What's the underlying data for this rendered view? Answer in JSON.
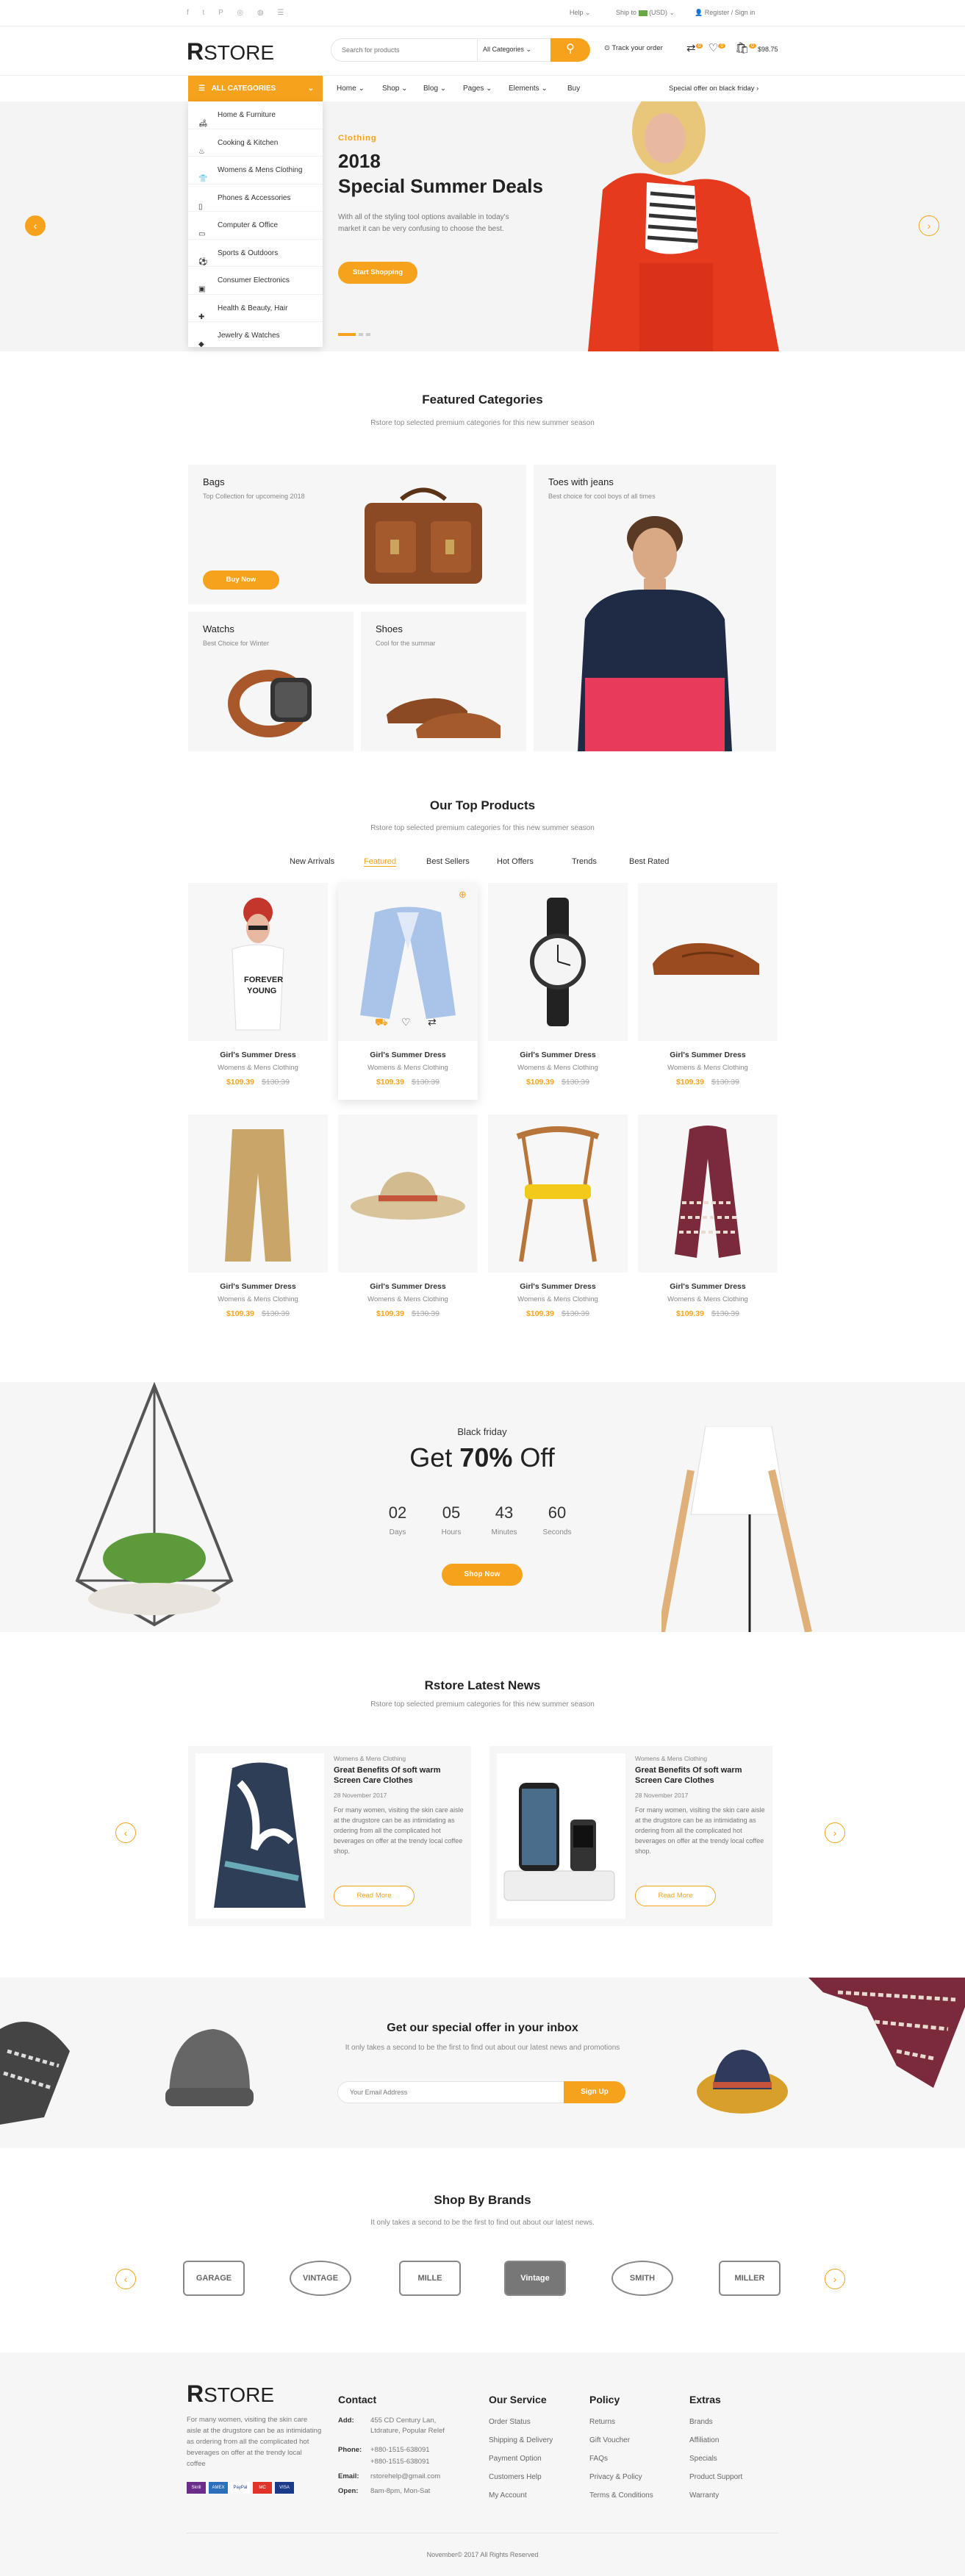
{
  "topbar": {
    "help": "Help",
    "ship_to": "Ship to",
    "currency": "(USD)",
    "register": "Register / Sign in"
  },
  "header": {
    "logo_r": "R",
    "logo_store": "STORE",
    "search_placeholder": "Search for products",
    "category_select": "All Categories",
    "track": "Track your order",
    "compare_count": "0",
    "wish_count": "0",
    "cart_count": "0",
    "cart_total": "$98.75"
  },
  "nav": {
    "all_categories": "ALL CATEGORIES",
    "items": [
      "Home",
      "Shop",
      "Blog",
      "Pages",
      "Elements",
      "Buy"
    ],
    "offer": "Special offer on black friday"
  },
  "sidebar": [
    "Home & Furniture",
    "Cooking & Kitchen",
    "Womens & Mens Clothing",
    "Phones & Accessories",
    "Computer & Office",
    "Sports & Outdoors",
    "Consumer Electronics",
    "Health & Beauty, Hair",
    "Jewelry & Watches"
  ],
  "hero": {
    "tag": "Clothing",
    "year": "2018",
    "title": "Special Summer Deals",
    "desc": "With all of the styling tool options available in today's market it can be very confusing to choose the best.",
    "button": "Start Shopping"
  },
  "featured": {
    "title": "Featured Categories",
    "subtitle": "Rstore top selected premium categories for this new summer season",
    "bags_title": "Bags",
    "bags_sub": "Top Collection for upcomeing 2018",
    "bags_btn": "Buy Now",
    "toes_title": "Toes with jeans",
    "toes_sub": "Best choice for cool boys of all times",
    "watches_title": "Watchs",
    "watches_sub": "Best Choice for Winter",
    "shoes_title": "Shoes",
    "shoes_sub": "Cool for the summar"
  },
  "top_products": {
    "title": "Our Top Products",
    "subtitle": "Rstore top selected premium categories for this new summer season",
    "tabs": [
      "New Arrivals",
      "Featured",
      "Best Sellers",
      "Hot Offers",
      "Trends",
      "Best Rated"
    ],
    "products": [
      {
        "name": "Girl's Summer Dress",
        "cat": "Womens & Mens Clothing",
        "price": "$109.39",
        "old": "$130.39"
      },
      {
        "name": "Girl's Summer Dress",
        "cat": "Womens & Mens Clothing",
        "price": "$109.39",
        "old": "$130.39"
      },
      {
        "name": "Girl's Summer Dress",
        "cat": "Womens & Mens Clothing",
        "price": "$109.39",
        "old": "$130.39"
      },
      {
        "name": "Girl's Summer Dress",
        "cat": "Womens & Mens Clothing",
        "price": "$109.39",
        "old": "$130.39"
      },
      {
        "name": "Girl's Summer Dress",
        "cat": "Womens & Mens Clothing",
        "price": "$109.39",
        "old": "$130.39"
      },
      {
        "name": "Girl's Summer Dress",
        "cat": "Womens & Mens Clothing",
        "price": "$109.39",
        "old": "$130.39"
      },
      {
        "name": "Girl's Summer Dress",
        "cat": "Womens & Mens Clothing",
        "price": "$109.39",
        "old": "$130.39"
      },
      {
        "name": "Girl's Summer Dress",
        "cat": "Womens & Mens Clothing",
        "price": "$109.39",
        "old": "$130.39"
      }
    ]
  },
  "black_friday": {
    "label": "Black friday",
    "get": "Get",
    "pct": "70%",
    "off": "Off",
    "days": "02",
    "days_l": "Days",
    "hours": "05",
    "hours_l": "Hours",
    "minutes": "43",
    "minutes_l": "Minutes",
    "seconds": "60",
    "seconds_l": "Seconds",
    "button": "Shop Now"
  },
  "news": {
    "title": "Rstore Latest News",
    "subtitle": "Rstore top selected premium categories for this new summer season",
    "items": [
      {
        "cat": "Womens & Mens Clothing",
        "title": "Great Benefits Of soft warm Screen Care Clothes",
        "date": "28 November 2017",
        "body": "For many women, visiting the skin care aisle at the drugstore can be as intimidating as ordering from all the complicated hot beverages on offer at the trendy local coffee shop.",
        "btn": "Read More"
      },
      {
        "cat": "Womens & Mens Clothing",
        "title": "Great Benefits Of soft warm Screen Care Clothes",
        "date": "28 November 2017",
        "body": "For many women, visiting the skin care aisle at the drugstore can be as intimidating as ordering from all the complicated hot beverages on offer at the trendy local coffee shop.",
        "btn": "Read More"
      }
    ]
  },
  "newsletter": {
    "title": "Get our special offer in your inbox",
    "subtitle": "It only takes a second to be the first to find out about our latest news and promotions",
    "placeholder": "Your Email Address",
    "button": "Sign Up"
  },
  "brands": {
    "title": "Shop By Brands",
    "subtitle": "It only takes a second to be the first to find out about our latest news.",
    "names": [
      "GARAGE",
      "VINTAGE",
      "MILLE",
      "Vintage",
      "SMITH",
      "MILLER"
    ]
  },
  "footer": {
    "logo_r": "R",
    "logo_store": "STORE",
    "about": "For many women, visiting the skin care aisle at the drugstore can be as intimidating as ordering from all the complicated hot beverages on offer at the trendy local coffee",
    "contact_title": "Contact",
    "add_l": "Add:",
    "add_v": "455 CD Century Lan, Ltdrature, Popular Relef",
    "phone_l": "Phone:",
    "phone1": "+880-1515-638091",
    "phone2": "+880-1515-638091",
    "email_l": "Email:",
    "email_v": "rstorehelp@gmail.com",
    "open_l": "Open:",
    "open_v": "8am-8pm, Mon-Sat",
    "service_title": "Our Service",
    "service": [
      "Order Status",
      "Shipping & Delivery",
      "Payment Option",
      "Customers Help",
      "My Account"
    ],
    "policy_title": "Policy",
    "policy": [
      "Returns",
      "Gift Voucher",
      "FAQs",
      "Privacy & Policy",
      "Terms & Conditions"
    ],
    "extras_title": "Extras",
    "extras": [
      "Brands",
      "Affiliation",
      "Specials",
      "Product Support",
      "Warranty"
    ],
    "cards": [
      "Skrill",
      "AMEX",
      "PayPal",
      "MC",
      "VISA"
    ],
    "copyright": "November© 2017 All Rights Reserved"
  },
  "colors": {
    "accent": "#f6a21d",
    "dark": "#222222",
    "light_bg": "#f6f6f6"
  }
}
